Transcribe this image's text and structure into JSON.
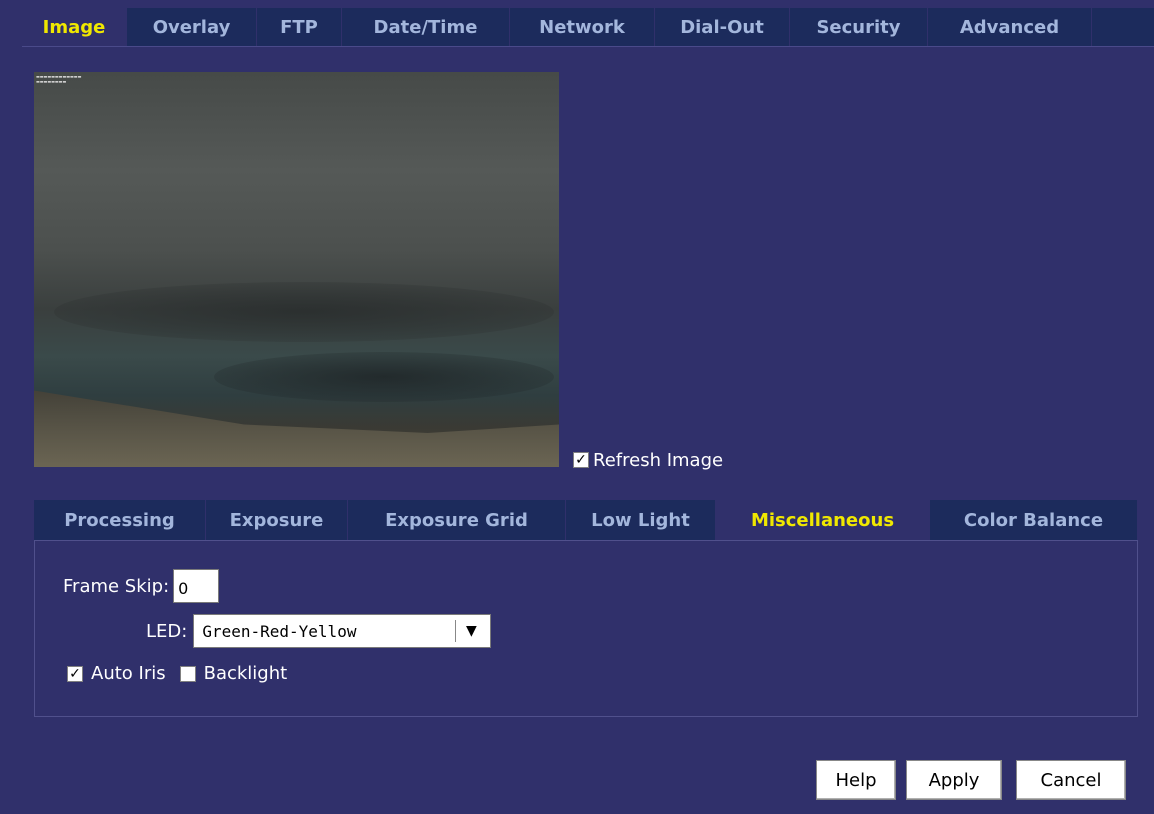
{
  "top_tabs": [
    {
      "label": "Image",
      "active": true
    },
    {
      "label": "Overlay",
      "active": false
    },
    {
      "label": "FTP",
      "active": false
    },
    {
      "label": "Date/Time",
      "active": false
    },
    {
      "label": "Network",
      "active": false
    },
    {
      "label": "Dial-Out",
      "active": false
    },
    {
      "label": "Security",
      "active": false
    },
    {
      "label": "Advanced",
      "active": false
    }
  ],
  "refresh": {
    "label": "Refresh Image",
    "checked": true
  },
  "sub_tabs": [
    {
      "label": "Processing",
      "active": false
    },
    {
      "label": "Exposure",
      "active": false
    },
    {
      "label": "Exposure Grid",
      "active": false
    },
    {
      "label": "Low Light",
      "active": false
    },
    {
      "label": "Miscellaneous",
      "active": true
    },
    {
      "label": "Color Balance",
      "active": false
    }
  ],
  "misc": {
    "frame_skip_label": "Frame Skip:",
    "frame_skip_value": "0",
    "led_label": "LED:",
    "led_value": "Green-Red-Yellow",
    "auto_iris_label": "Auto Iris",
    "auto_iris_checked": true,
    "backlight_label": "Backlight",
    "backlight_checked": false
  },
  "buttons": {
    "help": "Help",
    "apply": "Apply",
    "cancel": "Cancel"
  },
  "colors": {
    "background": "#30306b",
    "tab_inactive": "#1c2b5c",
    "tab_text": "#a3b6dc",
    "tab_active_text": "#f0e800"
  }
}
